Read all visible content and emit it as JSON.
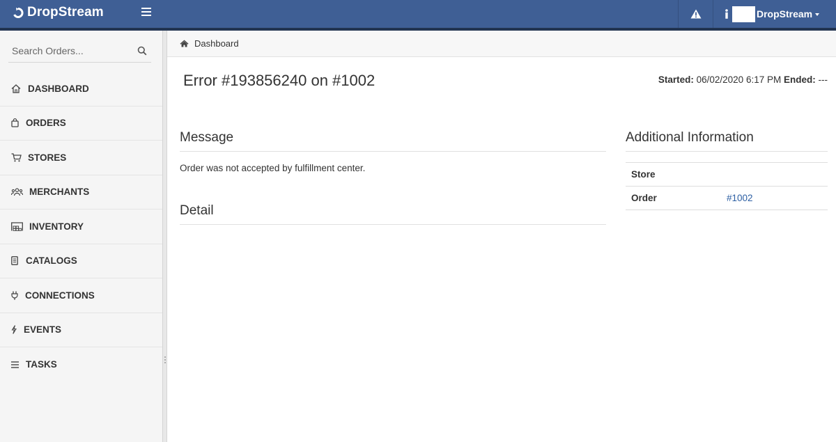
{
  "app": {
    "brand": "DropStream",
    "user_name": "DropStream"
  },
  "sidebar": {
    "search_placeholder": "Search Orders...",
    "items": [
      {
        "label": "DASHBOARD",
        "icon": "home-icon"
      },
      {
        "label": "ORDERS",
        "icon": "shopping-bag-icon"
      },
      {
        "label": "STORES",
        "icon": "cart-icon"
      },
      {
        "label": "MERCHANTS",
        "icon": "users-icon"
      },
      {
        "label": "INVENTORY",
        "icon": "warehouse-icon"
      },
      {
        "label": "CATALOGS",
        "icon": "book-icon"
      },
      {
        "label": "CONNECTIONS",
        "icon": "plug-icon"
      },
      {
        "label": "EVENTS",
        "icon": "bolt-icon"
      },
      {
        "label": "TASKS",
        "icon": "list-icon"
      }
    ]
  },
  "breadcrumb": {
    "label": "Dashboard"
  },
  "page": {
    "title": "Error #193856240 on #1002",
    "started_label": "Started:",
    "started_value": "06/02/2020 6:17 PM",
    "ended_label": "Ended:",
    "ended_value": "---"
  },
  "message": {
    "heading": "Message",
    "text": "Order was not accepted by fulfillment center."
  },
  "detail": {
    "heading": "Detail"
  },
  "additional": {
    "heading": "Additional Information",
    "rows": [
      {
        "key": "Store",
        "value": ""
      },
      {
        "key": "Order",
        "value": "#1002"
      }
    ]
  },
  "colors": {
    "topbar": "#3f5f95",
    "accent_link": "#2d5fa3",
    "sidebar_bg": "#f5f5f5"
  }
}
